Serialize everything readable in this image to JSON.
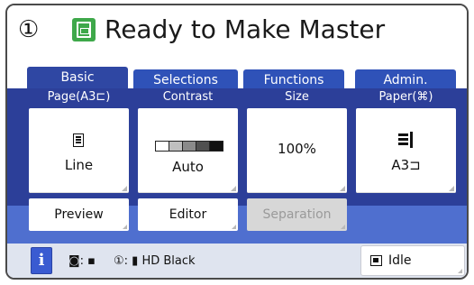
{
  "header": {
    "step_number": "①",
    "title": "Ready to Make Master"
  },
  "tabs": [
    {
      "label": "Basic",
      "active": true
    },
    {
      "label": "Selections",
      "active": false
    },
    {
      "label": "Functions",
      "active": false
    },
    {
      "label": "Admin.",
      "active": false
    }
  ],
  "settings": {
    "page": {
      "label": "Page(A3⊏)",
      "value": "Line",
      "icon": "document-icon"
    },
    "contrast": {
      "label": "Contrast",
      "value": "Auto",
      "icon": "contrast-scale-icon"
    },
    "size": {
      "label": "Size",
      "value": "100%"
    },
    "paper": {
      "label": "Paper(⌘)",
      "value": "A3⊐",
      "icon": "paper-tray-icon"
    }
  },
  "secondary_buttons": {
    "preview": "Preview",
    "editor": "Editor",
    "separation": "Separation"
  },
  "status_bar": {
    "info_label": "i",
    "drum_status": "◙: ▪",
    "ink_status": "①: ▮  HD Black",
    "idle_label": "Idle"
  },
  "colors": {
    "panel_blue": "#2c3f99",
    "strip_blue": "#4f6fcf",
    "accent_green": "#3ea84a"
  }
}
